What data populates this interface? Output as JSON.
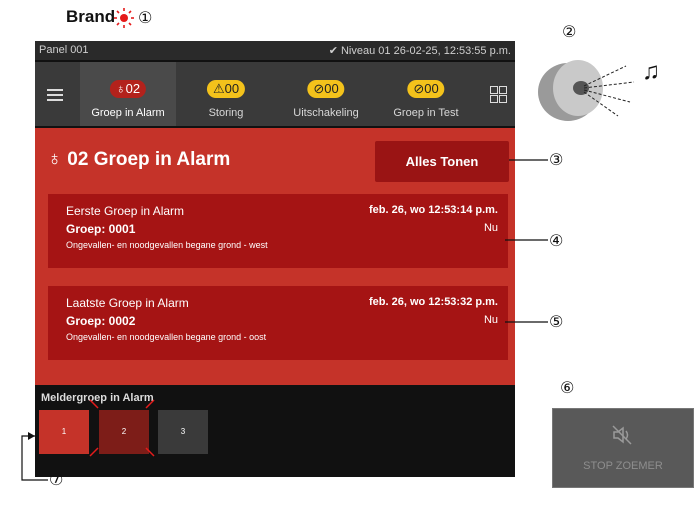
{
  "header": {
    "brand": "Brand"
  },
  "callouts": [
    "①",
    "②",
    "③",
    "④",
    "⑤",
    "⑥",
    "⑦"
  ],
  "topbar": {
    "panel": "Panel 001",
    "status": "✔ Niveau 01  26-02-25, 12:53:55 p.m."
  },
  "nav": {
    "items": [
      {
        "pill": "♁02",
        "label": "Groep in Alarm",
        "color": "#b3221c"
      },
      {
        "pill": "⚠00",
        "label": "Storing",
        "color": "#f3c21b"
      },
      {
        "pill": "⊘00",
        "label": "Uitschakeling",
        "color": "#f3c21b"
      },
      {
        "pill": "⊘00",
        "label": "Groep in Test",
        "color": "#f3c21b"
      }
    ]
  },
  "alarm": {
    "title": "02 Groep in Alarm",
    "show_all": "Alles Tonen",
    "cards": [
      {
        "title": "Eerste Groep in Alarm",
        "datetime": "feb. 26, wo 12:53:14 p.m.",
        "group": "Groep: 0001",
        "when": "Nu",
        "desc": "Ongevallen- en noodgevallen begane grond - west"
      },
      {
        "title": "Laatste Groep in Alarm",
        "datetime": "feb. 26, wo 12:53:32 p.m.",
        "group": "Groep: 0002",
        "when": "Nu",
        "desc": "Ongevallen- en noodgevallen begane grond - oost"
      }
    ]
  },
  "meldergroep": {
    "header": "Meldergroep in Alarm",
    "tiles": [
      "1",
      "2",
      "3"
    ]
  },
  "stop_zoemer": {
    "label": "STOP ZOEMER"
  },
  "colors": {
    "panel_bg": "#111111",
    "alarm_red": "#c53329",
    "card_red": "#a51414",
    "yellow": "#f3c21b"
  }
}
